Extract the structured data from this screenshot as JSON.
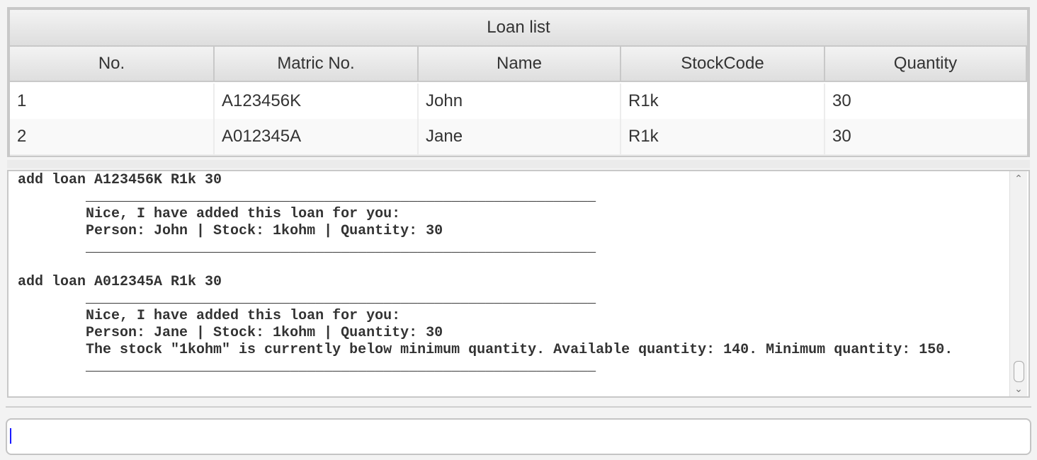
{
  "table": {
    "title": "Loan list",
    "columns": [
      "No.",
      "Matric No.",
      "Name",
      "StockCode",
      "Quantity"
    ],
    "rows": [
      [
        "1",
        "A123456K",
        "John",
        "R1k",
        "30"
      ],
      [
        "2",
        "A012345A",
        "Jane",
        "R1k",
        "30"
      ]
    ]
  },
  "console": {
    "lines": [
      "add loan A123456K R1k 30",
      "        ____________________________________________________________",
      "        Nice, I have added this loan for you:",
      "        Person: John | Stock: 1kohm | Quantity: 30",
      "        ____________________________________________________________",
      "",
      "add loan A012345A R1k 30",
      "        ____________________________________________________________",
      "        Nice, I have added this loan for you:",
      "        Person: Jane | Stock: 1kohm | Quantity: 30",
      "        The stock \"1kohm\" is currently below minimum quantity. Available quantity: 140. Minimum quantity: 150.",
      "        ____________________________________________________________"
    ]
  },
  "command_input": {
    "value": ""
  }
}
